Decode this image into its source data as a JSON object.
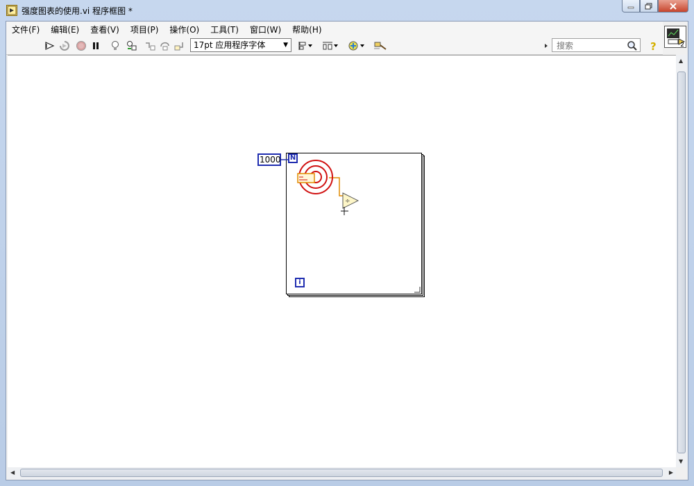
{
  "window": {
    "title": "强度图表的使用.vi 程序框图 *"
  },
  "menu": [
    {
      "label": "文件(F)"
    },
    {
      "label": "编辑(E)"
    },
    {
      "label": "查看(V)"
    },
    {
      "label": "项目(P)"
    },
    {
      "label": "操作(O)"
    },
    {
      "label": "工具(T)"
    },
    {
      "label": "窗口(W)"
    },
    {
      "label": "帮助(H)"
    }
  ],
  "toolbar": {
    "font_value": "17pt 应用程序字体",
    "search_placeholder": "搜索"
  },
  "vi_icon": {
    "connector_label": "2"
  },
  "diagram": {
    "count_constant": "1000",
    "loop_count_terminal": "N",
    "iteration_terminal": "i"
  },
  "colors": {
    "wire_blue": "#1f2db0",
    "random_node_red": "#d01010",
    "wire_orange": "#e08a00"
  },
  "icons": {
    "run": "run-arrow-icon",
    "run_continuously": "run-continuously-icon",
    "abort": "abort-icon",
    "pause": "pause-icon",
    "highlight_execution": "lightbulb-icon",
    "retain_wire_values": "retain-wire-icon",
    "step_into": "step-into-icon",
    "step_over": "step-over-icon",
    "step_out": "step-out-icon",
    "align": "align-objects-icon",
    "distribute": "distribute-objects-icon",
    "reorder": "reorder-icon",
    "cleanup": "cleanup-diagram-icon",
    "search": "magnifier-icon",
    "help": "help-question-icon"
  }
}
